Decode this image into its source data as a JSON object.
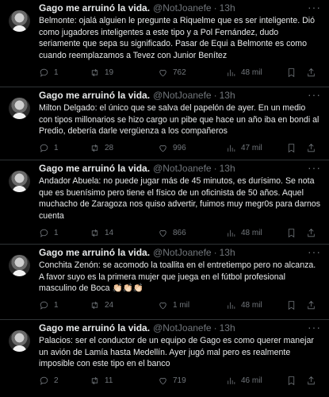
{
  "tweets": [
    {
      "name": "Gago me arruinó la vida.",
      "handle": "@NotJoanefe",
      "time": "13h",
      "text": "Belmonte: ojalá alguien le pregunte a Riquelme que es ser inteligente. Dió como jugadores inteligentes a este tipo y a Pol Fernández, dudo seriamente que sepa su significado. Pasar de Equi a Belmonte es como cuando reemplazamos a Tevez con Junior Benítez",
      "replies": "1",
      "retweets": "19",
      "likes": "762",
      "views": "48 mil"
    },
    {
      "name": "Gago me arruinó la vida.",
      "handle": "@NotJoanefe",
      "time": "13h",
      "text": "Milton Delgado: el único que se salva del papelón de ayer. En un medio con tipos millonarios se hizo cargo un pibe que hace un año iba en bondi al Predio, debería darle vergüenza a los compañeros",
      "replies": "1",
      "retweets": "28",
      "likes": "996",
      "views": "47 mil"
    },
    {
      "name": "Gago me arruinó la vida.",
      "handle": "@NotJoanefe",
      "time": "13h",
      "text": "Andador Abuela: no puede jugar más de 45 minutos, es durísimo. Se nota que es buenísimo pero tiene el físico de un oficinista de 50 años. Aquel muchacho de Zaragoza nos quiso advertir, fuimos muy megr0s para darnos cuenta",
      "replies": "1",
      "retweets": "14",
      "likes": "866",
      "views": "48 mil"
    },
    {
      "name": "Gago me arruinó la vida.",
      "handle": "@NotJoanefe",
      "time": "13h",
      "text": "Conchita Zenón: se acomodo la toallita en el entretiempo pero no alcanza. A favor suyo es la primera mujer que juega en el fútbol profesional masculino de Boca 👏🏻👏🏻👏🏻",
      "replies": "1",
      "retweets": "24",
      "likes": "1 mil",
      "views": "48 mil"
    },
    {
      "name": "Gago me arruinó la vida.",
      "handle": "@NotJoanefe",
      "time": "13h",
      "text": "Palacios: ser el conductor de un equipo de Gago es como querer manejar un avión de Lamía hasta Medellín. Ayer jugó mal pero es realmente imposible con este tipo en el banco",
      "replies": "2",
      "retweets": "11",
      "likes": "719",
      "views": "46 mil"
    }
  ],
  "icons": {
    "avatar": "avatar",
    "more": "more-dots-icon",
    "reply": "reply-icon",
    "retweet": "retweet-icon",
    "like": "heart-icon",
    "views": "views-icon",
    "bookmark": "bookmark-icon",
    "share": "share-icon"
  },
  "colors": {
    "background": "#000000",
    "text": "#e7e9ea",
    "muted": "#71767b",
    "divider": "#2f3336"
  }
}
